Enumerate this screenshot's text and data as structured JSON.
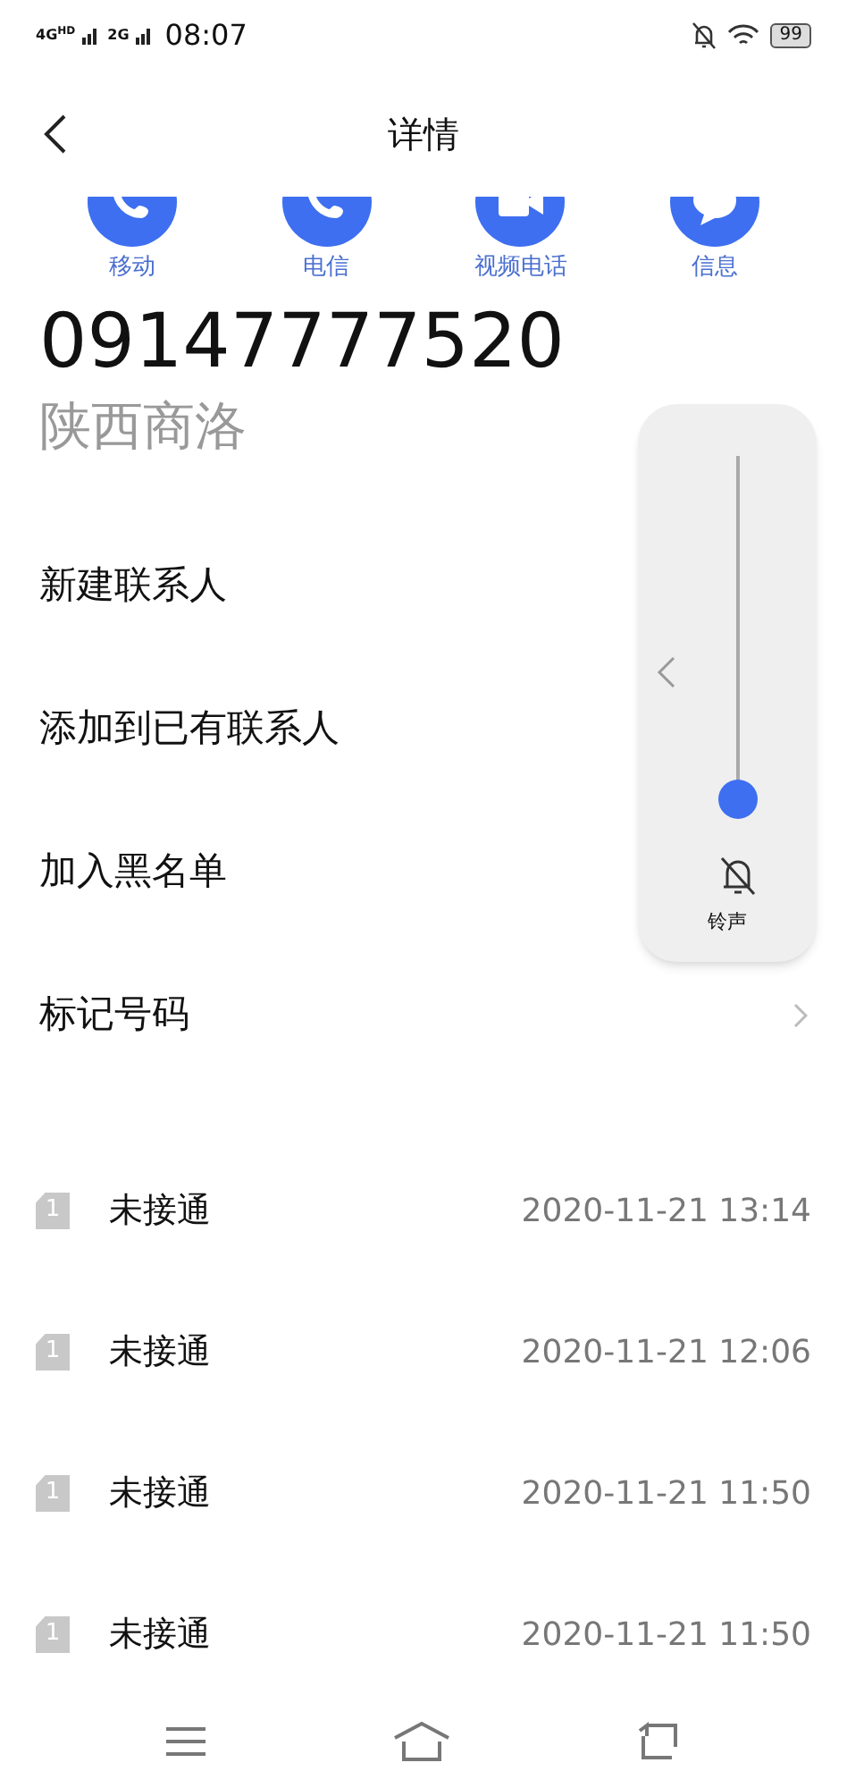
{
  "status_bar": {
    "network_1": "4G",
    "network_1_extra": "HD",
    "network_2": "2G",
    "time": "08:07",
    "battery": "99"
  },
  "header": {
    "title": "详情"
  },
  "actions": [
    {
      "label": "移动",
      "kind": "call"
    },
    {
      "label": "电信",
      "kind": "call"
    },
    {
      "label": "视频电话",
      "kind": "video"
    },
    {
      "label": "信息",
      "kind": "message"
    }
  ],
  "number": "09147777520",
  "location": "陕西商洛",
  "menu": [
    {
      "label": "新建联系人",
      "chevron": false
    },
    {
      "label": "添加到已有联系人",
      "chevron": false
    },
    {
      "label": "加入黑名单",
      "chevron": false
    },
    {
      "label": "标记号码",
      "chevron": true
    }
  ],
  "calls": [
    {
      "sim": "1",
      "status": "未接通",
      "time": "2020-11-21 13:14"
    },
    {
      "sim": "1",
      "status": "未接通",
      "time": "2020-11-21 12:06"
    },
    {
      "sim": "1",
      "status": "未接通",
      "time": "2020-11-21 11:50"
    },
    {
      "sim": "1",
      "status": "未接通",
      "time": "2020-11-21 11:50"
    }
  ],
  "volume_panel": {
    "label": "铃声",
    "level": 0,
    "muted": true
  }
}
